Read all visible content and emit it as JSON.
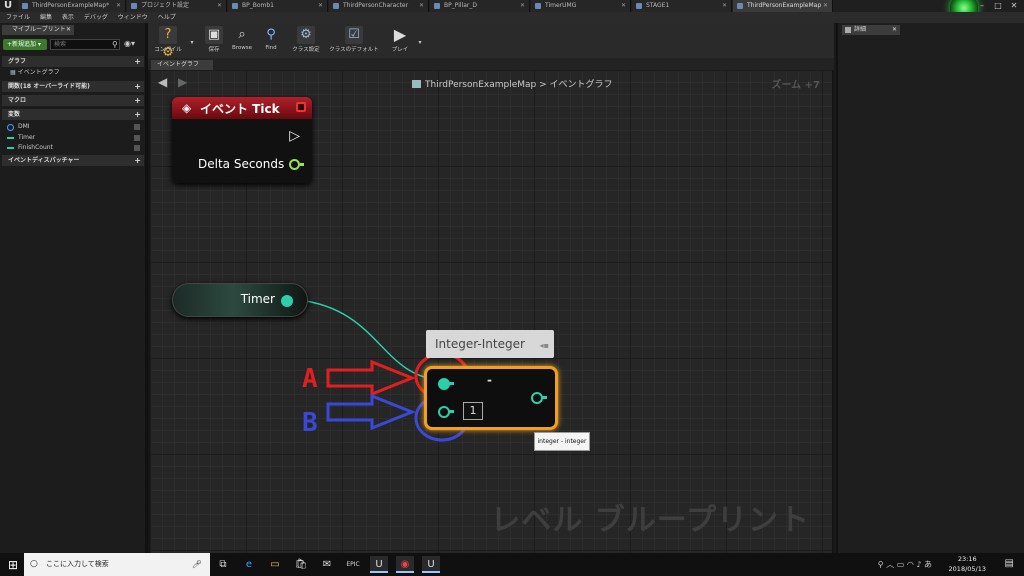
{
  "tabs": [
    {
      "label": "ThirdPersonExampleMap*",
      "active": false
    },
    {
      "label": "プロジェクト設定",
      "active": false
    },
    {
      "label": "BP_Bomb1",
      "active": false
    },
    {
      "label": "ThirdPersonCharacter",
      "active": false
    },
    {
      "label": "BP_Pillar_D",
      "active": false
    },
    {
      "label": "TimerUMG",
      "active": false
    },
    {
      "label": "STAGE1",
      "active": false
    },
    {
      "label": "ThirdPersonExampleMap",
      "active": true
    }
  ],
  "window_controls": [
    "–",
    "□",
    "✕"
  ],
  "menu": [
    "ファイル",
    "編集",
    "表示",
    "デバッグ",
    "ウィンドウ",
    "ヘルプ"
  ],
  "left_panel": {
    "tab_label": "マイブループリント",
    "add_new": "+新規追加 ▾",
    "search_placeholder": "検索",
    "sections": {
      "graph": "グラフ",
      "event_graph": "イベントグラフ",
      "functions": "関数",
      "functions_sub": "(18 オーバーライド可能)",
      "macros": "マクロ",
      "variables": "変数",
      "dispatchers": "イベントディスパッチャー"
    },
    "variables": [
      {
        "name": "DMI",
        "type": "circle",
        "color": "#4aa0ff"
      },
      {
        "name": "Timer",
        "type": "line",
        "color": "#2bd0a8"
      },
      {
        "name": "FinishCount",
        "type": "line",
        "color": "#2bd0a8"
      }
    ]
  },
  "toolbar": {
    "compile": "コンパイル",
    "save": "保存",
    "browse": "Browse",
    "find": "Find",
    "class_settings": "クラス設定",
    "class_defaults": "クラスのデフォルト",
    "play": "プレイ"
  },
  "graph": {
    "tab_label": "イベントグラフ",
    "breadcrumb_map": "ThirdPersonExampleMap",
    "breadcrumb_sep": ">",
    "breadcrumb_graph": "イベントグラフ",
    "zoom": "ズーム +7",
    "watermark": "レベル ブループリント"
  },
  "nodes": {
    "event_tick": {
      "title": "イベント Tick",
      "output_label": "Delta Seconds"
    },
    "timer": {
      "label": "Timer"
    },
    "subtract": {
      "title": "Integer-Integer",
      "operator": "-",
      "b_value": "1",
      "tooltip": "integer - integer"
    }
  },
  "annotations": {
    "a": {
      "letter": "A",
      "color": "#e02020"
    },
    "b": {
      "letter": "B",
      "color": "#3a48d8"
    }
  },
  "right_panel": {
    "tab_label": "詳細"
  },
  "taskbar": {
    "search_placeholder": "ここに入力して検索",
    "time": "23:16",
    "date": "2018/05/13"
  }
}
